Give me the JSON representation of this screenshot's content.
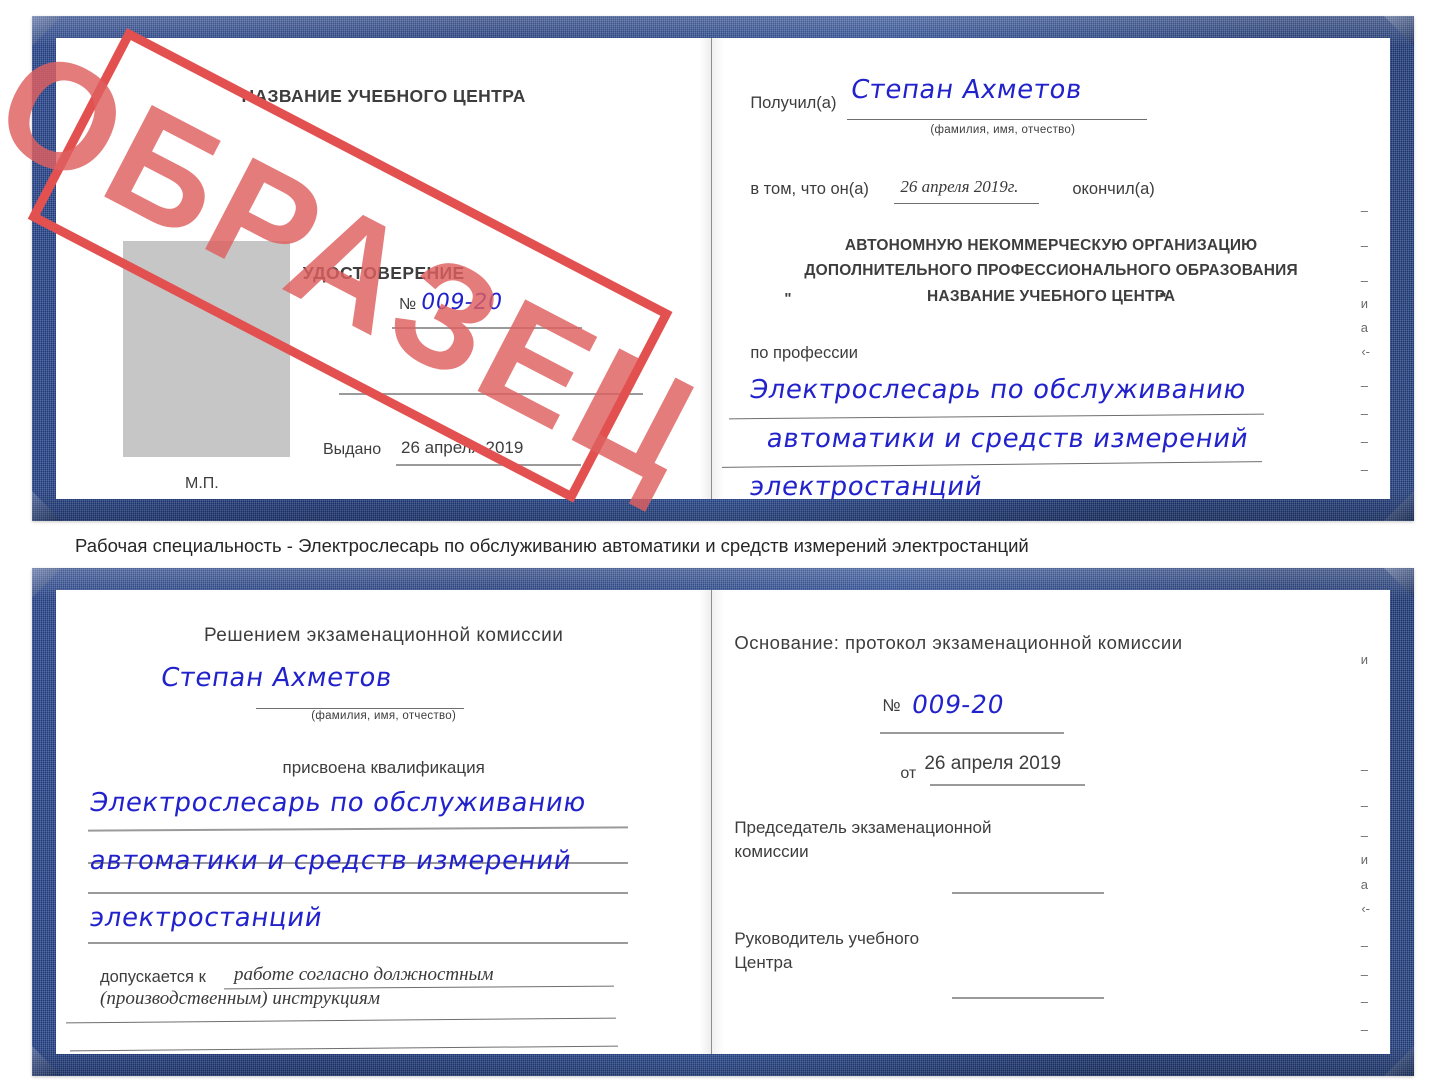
{
  "caption": {
    "text": "Рабочая специальность - Электрослесарь по обслуживанию автоматики и средств измерений электростанций"
  },
  "stamp": {
    "label": "ОБРАЗЕЦ",
    "color": "#e35050"
  },
  "colors": {
    "cover_blue": "#24407f",
    "handwriting_blue": "#2222cc",
    "stamp_red": "#e35050",
    "photo_gray": "#c6c6c6",
    "rule_gray": "#9a9a9a"
  },
  "certificate_top": {
    "left_page": {
      "center_name": "НАЗВАНИЕ УЧЕБНОГО ЦЕНТРА",
      "doc_title": "УДОСТОВЕРЕНИЕ",
      "number_label": "№",
      "number_value": "009-20",
      "issued_label": "Выдано",
      "issued_value": "26 апреля 2019",
      "seal_label": "М.П."
    },
    "right_page": {
      "received_label": "Получил(а)",
      "received_value": "Степан Ахметов",
      "received_hint": "(фамилия, имя, отчество)",
      "that_he_label": "в том, что он(а)",
      "that_he_value": "26 апреля 2019г.",
      "finished_label": "окончил(а)",
      "org_line1": "АВТОНОМНУЮ НЕКОММЕРЧЕСКУЮ ОРГАНИЗАЦИЮ",
      "org_line2": "ДОПОЛНИТЕЛЬНОГО ПРОФЕССИОНАЛЬНОГО ОБРАЗОВАНИЯ",
      "org_quote_open": "\"",
      "org_line3": "НАЗВАНИЕ УЧЕБНОГО ЦЕНТРА",
      "org_quote_close": "\"",
      "profession_label": "по профессии",
      "profession_line1": "Электрослесарь по обслуживанию",
      "profession_line2": "автоматики и средств измерений",
      "profession_line3": "электростанций",
      "edge_fragments": [
        "–",
        "–",
        "–",
        "и",
        "а",
        "‹-",
        "–",
        "–",
        "–",
        "–"
      ]
    }
  },
  "certificate_bottom": {
    "left_page": {
      "heading": "Решением экзаменационной комиссии",
      "name_value": "Степан Ахметов",
      "name_hint": "(фамилия, имя, отчество)",
      "qualification_label": "присвоена квалификация",
      "qualification_line1": "Электрослесарь по обслуживанию",
      "qualification_line2": "автоматики и средств измерений",
      "qualification_line3": "электростанций",
      "allowed_label": "допускается к",
      "allowed_value1": "работе согласно должностным",
      "allowed_value2": "(производственным) инструкциям"
    },
    "right_page": {
      "basis_label": "Основание: протокол экзаменационной комиссии",
      "number_label": "№",
      "number_value": "009-20",
      "date_label": "от",
      "date_value": "26 апреля 2019",
      "chairman_line1": "Председатель экзаменационной",
      "chairman_line2": "комиссии",
      "head_line1": "Руководитель учебного",
      "head_line2": "Центра",
      "edge_fragments": [
        "и",
        "–",
        "–",
        "–",
        "и",
        "а",
        "‹-",
        "–",
        "–",
        "–",
        "–"
      ]
    }
  }
}
